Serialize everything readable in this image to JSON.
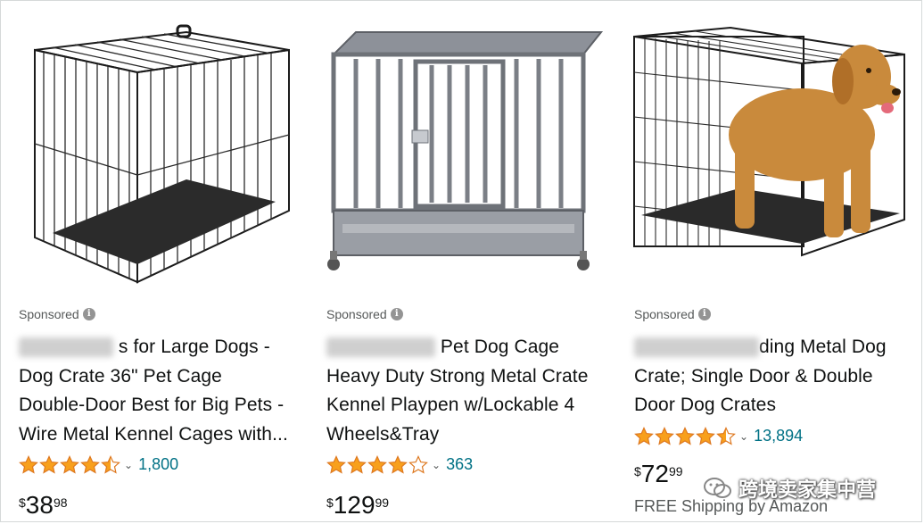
{
  "products": [
    {
      "sponsored_label": "Sponsored",
      "title_lines": [
        "■■■■■s for Large Dogs -",
        "Dog Crate 36\" Pet Cage",
        "Double-Door Best for Big Pets -",
        "Wire Metal Kennel Cages with..."
      ],
      "rating": 4.5,
      "review_count": "1,800",
      "price": {
        "symbol": "$",
        "whole": "38",
        "fraction": "98"
      }
    },
    {
      "sponsored_label": "Sponsored",
      "title_lines": [
        "■■■■■■■■ Pet Dog Cage",
        "Heavy Duty Strong Metal Crate",
        "Kennel Playpen w/Lockable 4",
        "Wheels&Tray"
      ],
      "rating": 4.0,
      "review_count": "363",
      "price": {
        "symbol": "$",
        "whole": "129",
        "fraction": "99"
      }
    },
    {
      "sponsored_label": "Sponsored",
      "title_lines": [
        "■■■■■■■■■■■ding Metal Dog",
        "Crate; Single Door & Double",
        "Door Dog Crates"
      ],
      "rating": 4.5,
      "review_count": "13,894",
      "price": {
        "symbol": "$",
        "whole": "72",
        "fraction": "99"
      },
      "shipping": "FREE Shipping by Amazon"
    }
  ],
  "watermark": "跨境卖家集中营",
  "colors": {
    "star": "#f8a01c",
    "link": "#007185",
    "muted": "#565959"
  }
}
